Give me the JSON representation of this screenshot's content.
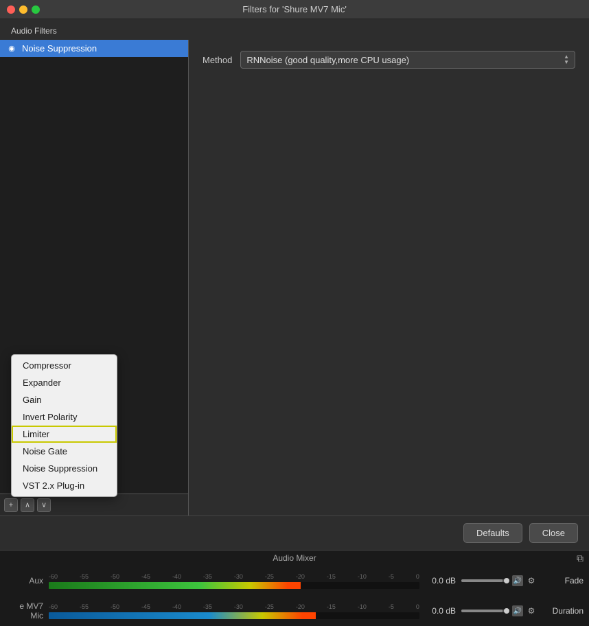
{
  "window": {
    "title": "Filters for 'Shure MV7 Mic'",
    "buttons": {
      "close": "×",
      "minimize": "–",
      "maximize": "+"
    }
  },
  "audio_filters_label": "Audio Filters",
  "filter_list": {
    "items": [
      {
        "label": "Noise Suppression",
        "selected": true,
        "visible": true
      }
    ],
    "toolbar_buttons": [
      "+",
      "∧",
      "∨"
    ]
  },
  "right_panel": {
    "method_label": "Method",
    "method_value": "RNNoise (good quality,more CPU usage)"
  },
  "bottom_buttons": {
    "defaults": "Defaults",
    "close": "Close"
  },
  "context_menu": {
    "items": [
      {
        "label": "Compressor",
        "highlighted": false
      },
      {
        "label": "Expander",
        "highlighted": false
      },
      {
        "label": "Gain",
        "highlighted": false
      },
      {
        "label": "Invert Polarity",
        "highlighted": false
      },
      {
        "label": "Limiter",
        "highlighted": true
      },
      {
        "label": "Noise Gate",
        "highlighted": false
      },
      {
        "label": "Noise Suppression",
        "highlighted": false
      },
      {
        "label": "VST 2.x Plug-in",
        "highlighted": false
      }
    ]
  },
  "audio_mixer": {
    "title": "Audio Mixer",
    "channels": [
      {
        "name": "Aux",
        "db": "0.0 dB",
        "scale_labels": [
          "-60",
          "-55",
          "-50",
          "-45",
          "-40",
          "-35",
          "-30",
          "-25",
          "-20",
          "-15",
          "-10",
          "-5",
          "0"
        ],
        "meter_fill": 68
      },
      {
        "name": "e MV7 Mic",
        "db": "0.0 dB",
        "scale_labels": [
          "-60",
          "-55",
          "-50",
          "-45",
          "-40",
          "-35",
          "-30",
          "-25",
          "-20",
          "-15",
          "-10",
          "-5",
          "0"
        ],
        "meter_fill": 72
      }
    ],
    "fade_label": "Fade",
    "duration_label": "Duration"
  }
}
